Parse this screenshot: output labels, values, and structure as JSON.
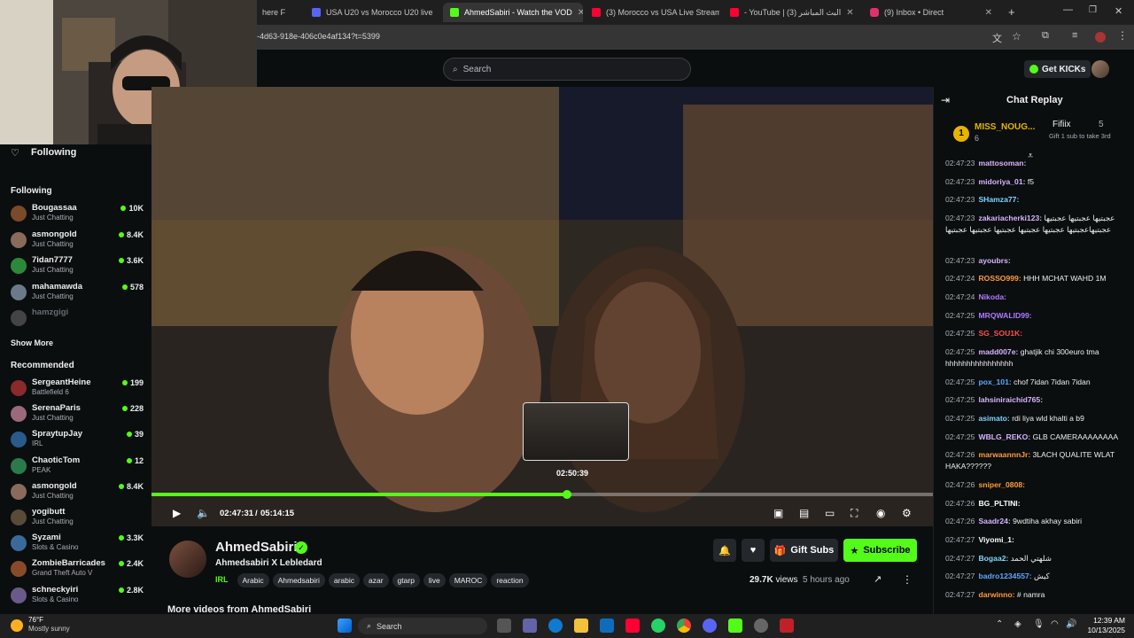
{
  "browser": {
    "tabs": [
      {
        "label": "here F",
        "color": "#6c6c6c",
        "active": false
      },
      {
        "label": "USA U20 vs Morocco U20 live",
        "color": "#5865f2",
        "active": false
      },
      {
        "label": "AhmedSabiri - Watch the VOD",
        "color": "#53fc18",
        "active": true
      },
      {
        "label": "(3) Morocco vs USA Live Stream",
        "color": "#ff0033",
        "active": false
      },
      {
        "label": "- YouTube | البث المباشر (3)",
        "color": "#ff0033",
        "active": false
      },
      {
        "label": "(9) Inbox • Direct",
        "color": "#e1306c",
        "active": false
      }
    ],
    "url": "-4d63-918e-406c0e4af134?t=5399"
  },
  "header": {
    "search_placeholder": "Search",
    "get_kicks": "Get KICKs"
  },
  "sidebar": {
    "following_title": "Following",
    "following_section": "Following",
    "following": [
      {
        "name": "Bougassaa",
        "category": "Just Chatting",
        "viewers": "10K",
        "color": "#7a4a2a"
      },
      {
        "name": "asmongold",
        "category": "Just Chatting",
        "viewers": "8.4K",
        "color": "#8a6a5a"
      },
      {
        "name": "7idan7777",
        "category": "Just Chatting",
        "viewers": "3.6K",
        "color": "#2a8a3a"
      },
      {
        "name": "mahamawda",
        "category": "Just Chatting",
        "viewers": "578",
        "color": "#6a7a8a"
      },
      {
        "name": "hamzgigi",
        "category": "",
        "viewers": "",
        "color": "#444"
      }
    ],
    "show_more": "Show More",
    "recommended_section": "Recommended",
    "recommended": [
      {
        "name": "SergeantHeine",
        "category": "Battlefield 6",
        "viewers": "199",
        "color": "#8a2a2a"
      },
      {
        "name": "SerenaParis",
        "category": "Just Chatting",
        "viewers": "228",
        "color": "#9a6a7a"
      },
      {
        "name": "SpraytupJay",
        "category": "IRL",
        "viewers": "39",
        "color": "#2a5a8a"
      },
      {
        "name": "ChaoticTom",
        "category": "PEAK",
        "viewers": "12",
        "color": "#2a7a4a"
      },
      {
        "name": "asmongold",
        "category": "Just Chatting",
        "viewers": "8.4K",
        "color": "#8a6a5a"
      },
      {
        "name": "yogibutt",
        "category": "Just Chatting",
        "viewers": "",
        "color": "#5a4a3a"
      },
      {
        "name": "Syzami",
        "category": "Slots & Casino",
        "viewers": "3.3K",
        "color": "#3a6a9a"
      },
      {
        "name": "ZombieBarricades",
        "category": "Grand Theft Auto V",
        "viewers": "2.4K",
        "color": "#8a4a2a"
      },
      {
        "name": "schneckyiri",
        "category": "Slots & Casino",
        "viewers": "2.8K",
        "color": "#6a5a8a"
      }
    ]
  },
  "video": {
    "current_time": "02:47:31",
    "duration": "05:14:15",
    "time_separator": "/",
    "progress_fraction": 0.532,
    "hover_time": "02:50:39"
  },
  "stream": {
    "channel": "AhmedSabiri",
    "title": "Ahmedsabiri X Lebledard",
    "category": "IRL",
    "tags": [
      "Arabic",
      "Ahmedsabiri",
      "arabic",
      "azar",
      "gtarp",
      "live",
      "MAROC",
      "reaction"
    ],
    "views": "29.7K",
    "views_label": "views",
    "time_ago": "5 hours ago",
    "gift_subs": "Gift Subs",
    "subscribe": "Subscribe",
    "more_videos": "More videos from AhmedSabiri"
  },
  "chat": {
    "title": "Chat Replay",
    "leader1_rank": "1",
    "leader1_name": "MISS_NOUG...",
    "leader1_count": "6",
    "leader2_name": "Fifiix",
    "leader2_count": "5",
    "leader2_note": "Gift 1 sub to take 3rd",
    "messages": [
      {
        "ts": "02:47:23",
        "user": "mattosoman:",
        "color": "#d8b4ff",
        "text": ""
      },
      {
        "ts": "02:47:23",
        "user": "midoriya_01:",
        "color": "#d8b4ff",
        "text": "f5"
      },
      {
        "ts": "02:47:23",
        "user": "SHamza77:",
        "color": "#7fd6ff",
        "text": ""
      },
      {
        "ts": "02:47:23",
        "user": "zakariacherki123:",
        "color": "#d8b4ff",
        "text": "عجبتيها عجبتيها عجبتيها عجبتيهاعجبتيها عجبتيها عجبتيها عجبتيها عجبتيها عجبتيها"
      },
      {
        "ts": "02:47:23",
        "user": "ayoubrs:",
        "color": "#d8b4ff",
        "text": ""
      },
      {
        "ts": "02:47:24",
        "user": "ROSSO999:",
        "color": "#ff9b3d",
        "text": "HHH MCHAT WAHD 1M"
      },
      {
        "ts": "02:47:24",
        "user": "Nikoda:",
        "color": "#b07cff",
        "text": ""
      },
      {
        "ts": "02:47:25",
        "user": "MRQWALID99:",
        "color": "#b07cff",
        "text": ""
      },
      {
        "ts": "02:47:25",
        "user": "SG_SOU1K:",
        "color": "#ff4d4d",
        "text": ""
      },
      {
        "ts": "02:47:25",
        "user": "madd007e:",
        "color": "#d8b4ff",
        "text": "ghatjik chi 300euro tma hhhhhhhhhhhhhhhh"
      },
      {
        "ts": "02:47:25",
        "user": "pox_101:",
        "color": "#5ea8ff",
        "text": "chof 7idan 7idan 7idan"
      },
      {
        "ts": "02:47:25",
        "user": "lahsiniraichid765:",
        "color": "#d8b4ff",
        "text": ""
      },
      {
        "ts": "02:47:25",
        "user": "asimato:",
        "color": "#7fd6ff",
        "text": "rdi liya wld khalti a b9"
      },
      {
        "ts": "02:47:25",
        "user": "WBLG_REKO:",
        "color": "#d8b4ff",
        "text": "GLB CAMERAAAAAAAA"
      },
      {
        "ts": "02:47:26",
        "user": "marwaannnJr:",
        "color": "#ff9b3d",
        "text": "3LACH QUALITE WLAT HAKA??????"
      },
      {
        "ts": "02:47:26",
        "user": "sniper_0808:",
        "color": "#ff9b3d",
        "text": ""
      },
      {
        "ts": "02:47:26",
        "user": "BG_PLTINI:",
        "color": "#ffffff",
        "text": ""
      },
      {
        "ts": "02:47:26",
        "user": "Saadr24:",
        "color": "#d8b4ff",
        "text": "9wdtiha akhay sabiri"
      },
      {
        "ts": "02:47:27",
        "user": "Viyomi_1:",
        "color": "#ffffff",
        "text": ""
      },
      {
        "ts": "02:47:27",
        "user": "Bogaa2:",
        "color": "#7fd6ff",
        "text": "شلهتي الحمد"
      },
      {
        "ts": "02:47:27",
        "user": "badro1234557:",
        "color": "#5ea8ff",
        "text": "كيش"
      },
      {
        "ts": "02:47:27",
        "user": "darwinno:",
        "color": "#ff9b3d",
        "text": "# namra"
      }
    ]
  },
  "taskbar": {
    "weather_temp": "76°F",
    "weather_text": "Mostly sunny",
    "search_label": "Search",
    "time": "12:39 AM",
    "date": "10/13/2025"
  }
}
